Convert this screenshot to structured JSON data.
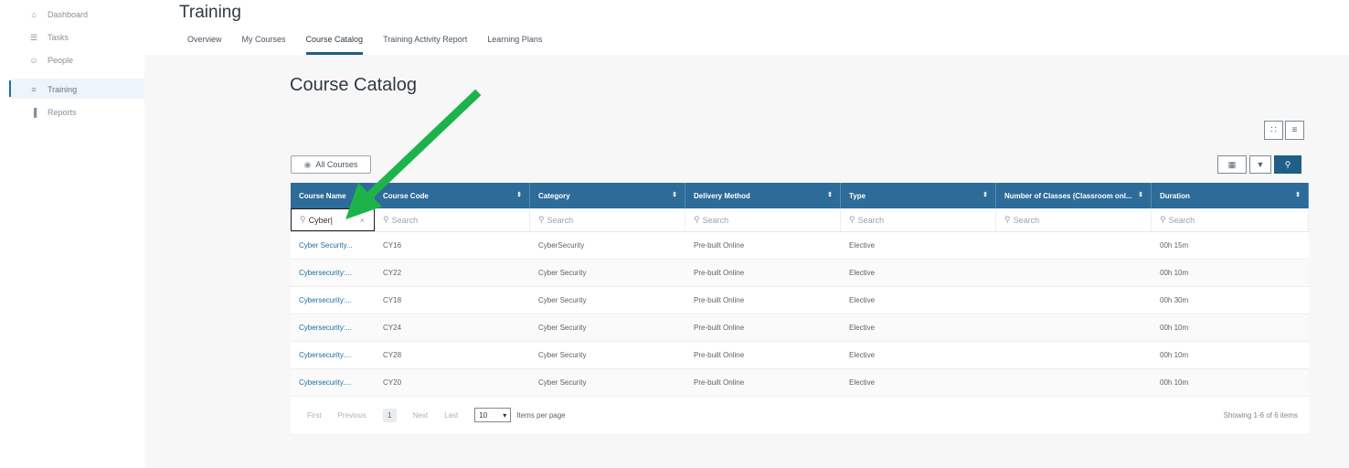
{
  "sidebar": {
    "items": [
      {
        "label": "Dashboard",
        "icon": "home-icon",
        "glyph": "⌂"
      },
      {
        "label": "Tasks",
        "icon": "tasks-icon",
        "glyph": "☰"
      },
      {
        "label": "People",
        "icon": "people-icon",
        "glyph": "☺"
      },
      {
        "label": "Training",
        "icon": "training-icon",
        "glyph": "≡"
      },
      {
        "label": "Reports",
        "icon": "reports-icon",
        "glyph": "▐"
      }
    ],
    "active": "Training"
  },
  "header": {
    "title": "Training",
    "tabs": [
      "Overview",
      "My Courses",
      "Course Catalog",
      "Training Activity Report",
      "Learning Plans"
    ],
    "active_tab": "Course Catalog"
  },
  "catalog": {
    "title": "Course Catalog",
    "filter_button": "All Courses",
    "columns": [
      "Course Name",
      "Course Code",
      "Category",
      "Delivery Method",
      "Type",
      "Number of Classes (Classroom onl...",
      "Duration"
    ],
    "filters": {
      "course_name_value": "Cyber|",
      "placeholder": "Search"
    },
    "rows": [
      [
        "Cyber Security...",
        "CY16",
        "CyberSecurity",
        "Pre-built Online",
        "Elective",
        "",
        "00h 15m"
      ],
      [
        "Cybersecurity:...",
        "CY22",
        "Cyber Security",
        "Pre-built Online",
        "Elective",
        "",
        "00h 10m"
      ],
      [
        "Cybersecurity:...",
        "CY18",
        "Cyber Security",
        "Pre-built Online",
        "Elective",
        "",
        "00h 30m"
      ],
      [
        "Cybersecurity:...",
        "CY24",
        "Cyber Security",
        "Pre-built Online",
        "Elective",
        "",
        "00h 10m"
      ],
      [
        "Cybersecurity....",
        "CY28",
        "Cyber Security",
        "Pre-built Online",
        "Elective",
        "",
        "00h 10m"
      ],
      [
        "Cybersecurity....",
        "CY20",
        "Cyber Security",
        "Pre-built Online",
        "Elective",
        "",
        "00h 10m"
      ]
    ],
    "pager": {
      "first": "First",
      "previous": "Previous",
      "current_page": "1",
      "next": "Next",
      "last": "Last",
      "page_size": "10",
      "per_page_label": "Items per page",
      "showing": "Showing 1-6 of 6 items"
    }
  },
  "annotation_arrow_color": "#1db34b",
  "accent_color": "#2d6b98"
}
